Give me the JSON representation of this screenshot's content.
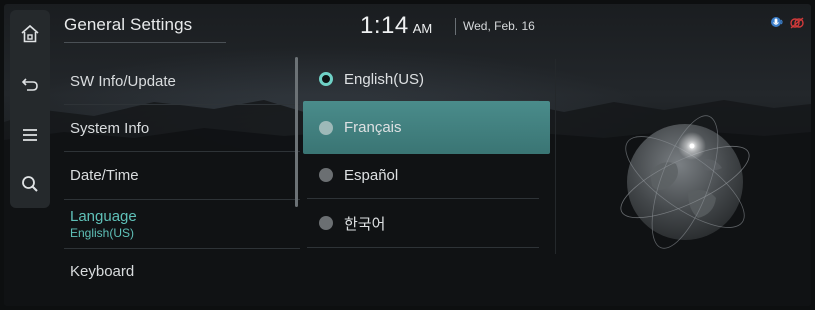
{
  "header": {
    "title": "General Settings",
    "time": "1:14",
    "ampm": "AM",
    "date": "Wed, Feb. 16"
  },
  "rail": {
    "icons": [
      "home-icon",
      "back-icon",
      "menu-icon",
      "search-icon"
    ]
  },
  "menu": {
    "items": [
      {
        "label": "SW Info/Update"
      },
      {
        "label": "System Info"
      },
      {
        "label": "Date/Time"
      },
      {
        "label": "Language",
        "sub": "English(US)"
      },
      {
        "label": "Keyboard"
      }
    ]
  },
  "languages": {
    "selected": "English(US)",
    "options": [
      {
        "label": "English(US)"
      },
      {
        "label": "Français"
      },
      {
        "label": "Español"
      },
      {
        "label": "한국어"
      }
    ]
  },
  "status": {
    "icons": [
      "voice-mic-icon",
      "no-connection-icon"
    ],
    "colors": {
      "voice": "#3b7ec9",
      "no_connection": "#d23a3a"
    }
  },
  "colors": {
    "accent": "#5fc0b8",
    "highlight": "#3f7f7f"
  }
}
